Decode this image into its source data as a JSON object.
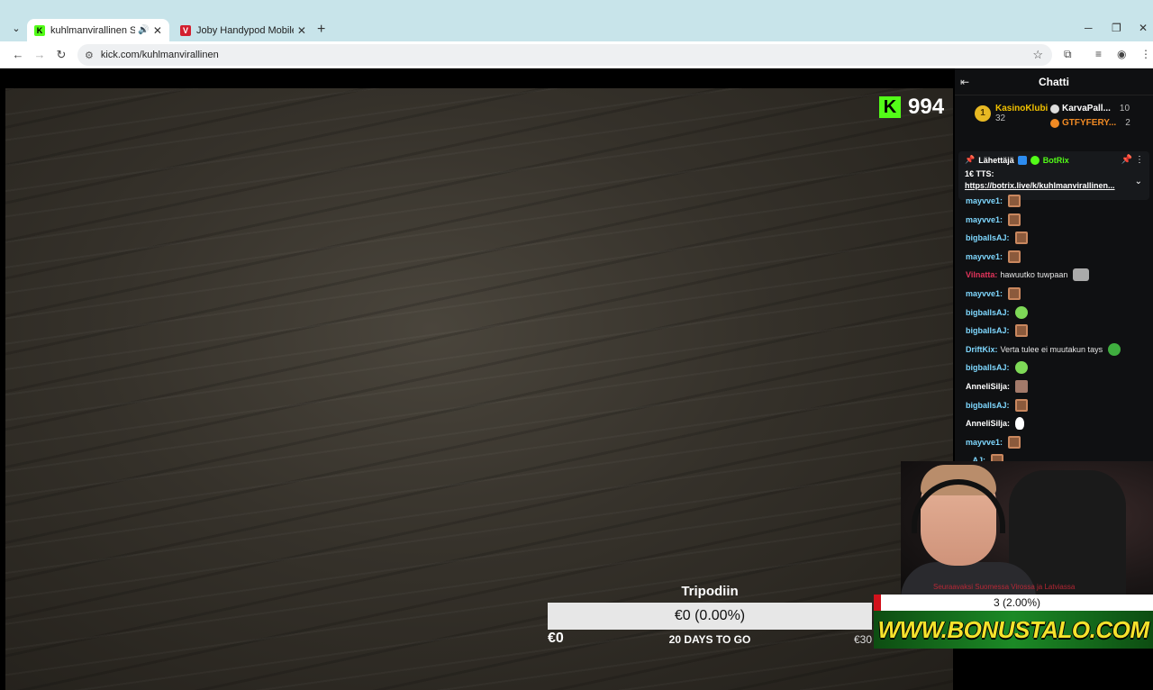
{
  "browser": {
    "tabs": [
      {
        "title": "kuhlmanvirallinen Stream -",
        "favicon": "K",
        "active": true,
        "audio": true
      },
      {
        "title": "Joby Handypod Mobile -minija",
        "favicon": "V",
        "active": false,
        "audio": false
      }
    ],
    "url": "kick.com/kuhlmanvirallinen",
    "accent": "#c8e4ea"
  },
  "stream": {
    "viewer_count": "994",
    "kick_green": "#53fc18"
  },
  "goal": {
    "title": "Tripodiin",
    "bar_text": "€0 (0.00%)",
    "progress": 0,
    "min_label": "€0",
    "days_left": "20 DAYS TO GO",
    "max_label": "€30"
  },
  "overlay": {
    "sub_goal_text": "3 (2.00%)",
    "banner_text": "WWW.BONUSTALO.COM",
    "red_scroll_text": "Seuraavaksi Suomessa Virossa ja Latviassa"
  },
  "chat": {
    "title": "Chatti",
    "leaderboard": [
      {
        "rank": "1",
        "name": "KasinoKlubi",
        "count": "32"
      },
      {
        "name": "KarvaPall...",
        "count": "10"
      },
      {
        "name": "GTFYFERY...",
        "count": "2"
      }
    ],
    "pinned": {
      "sender_label": "Lähettäjä",
      "sender": "BotRix",
      "text": "1€ TTS:",
      "link": "https://botrix.live/k/kuhlmanvirallinen..."
    },
    "messages": [
      {
        "user": "mayvve1:",
        "color": "#7fd8ff",
        "emote": "box"
      },
      {
        "user": "mayvve1:",
        "color": "#7fd8ff",
        "emote": "box"
      },
      {
        "user": "bigballsAJ:",
        "color": "#7fd8ff",
        "emote": "box"
      },
      {
        "user": "mayvve1:",
        "color": "#7fd8ff",
        "emote": "box"
      },
      {
        "user": "Vilnatta:",
        "color": "#e0335a",
        "text": "hawuutko tuwpaan",
        "emote": "cat"
      },
      {
        "user": "mayvve1:",
        "color": "#7fd8ff",
        "emote": "box"
      },
      {
        "user": "bigballsAJ:",
        "color": "#7fd8ff",
        "emote": "alien"
      },
      {
        "user": "bigballsAJ:",
        "color": "#7fd8ff",
        "emote": "box"
      },
      {
        "user": "DriftKix:",
        "color": "#7fd8ff",
        "text": "Verta tulee ei muutakun tays",
        "emote": "frog"
      },
      {
        "user": "bigballsAJ:",
        "color": "#7fd8ff",
        "emote": "alien"
      },
      {
        "user": "AnneliSilja:",
        "color": "#ffffff",
        "emote": "face"
      },
      {
        "user": "bigballsAJ:",
        "color": "#7fd8ff",
        "emote": "box"
      },
      {
        "user": "AnneliSilja:",
        "color": "#ffffff",
        "emote": "duck"
      },
      {
        "user": "mayvve1:",
        "color": "#7fd8ff",
        "emote": "box"
      },
      {
        "user": "...AJ:",
        "color": "#7fd8ff",
        "emote": "box"
      }
    ]
  }
}
